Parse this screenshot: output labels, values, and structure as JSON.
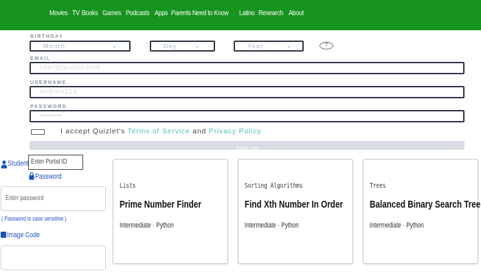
{
  "nav": {
    "links": [
      "Movies",
      "TV",
      "Books",
      "Games",
      "Podcasts",
      "Apps",
      "Parents Need to Know",
      "Latino",
      "Research",
      "About"
    ],
    "bg_color": "#17931f"
  },
  "signup": {
    "birthday_label": "BIRTHDAY",
    "month": "Month",
    "day": "Day",
    "year": "Year",
    "help_icon": "question-icon",
    "email_label": "EMAIL",
    "email_placeholder": "user@quizlet.com",
    "username_label": "USERNAME",
    "username_placeholder": "andrew123",
    "password_label": "PASSWORD",
    "password_placeholder": "••••••••",
    "terms_prefix": "I accept Quizlet's",
    "terms_link": "Terms of Service",
    "terms_and": "and",
    "privacy_link": "Privacy Policy",
    "signup_button": "Sign up",
    "accent_color": "#4fc0b0"
  },
  "login": {
    "student_id_label": "Student ID",
    "student_id_placeholder": "Enter Portal ID",
    "password_label": "Password",
    "password_placeholder": "Enter password",
    "password_note": "( Password is case sensitive )",
    "image_code_label": "Image Code",
    "image_code_value": "",
    "label_color": "#2255bb"
  },
  "cards": [
    {
      "category": "Lists",
      "title": "Prime Number Finder",
      "meta": "Intermediate · Python"
    },
    {
      "category": "Sorting Algorithms",
      "title": "Find Xth Number In Order",
      "meta": "Intermediate · Python"
    },
    {
      "category": "Trees",
      "title": "Balanced Binary Search Tree",
      "meta": "Intermediate · Python"
    }
  ]
}
